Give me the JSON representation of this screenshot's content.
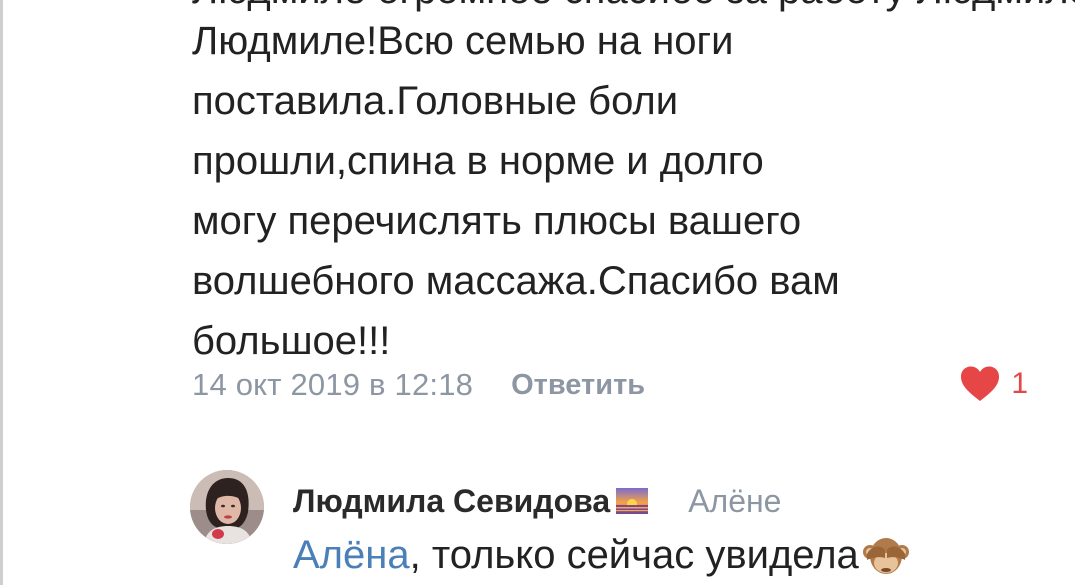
{
  "comment": {
    "cut_top_line": "Людмиле огромное спасибо за работу Людмиле",
    "lines": [
      "Людмиле!Всю семью на ноги",
      "поставила.Головные боли",
      "прошли,спина в норме и долго",
      "могу перечислять плюсы вашего",
      "волшебного массажа.Спасибо вам",
      "большое!!!"
    ],
    "timestamp": "14 окт 2019 в 12:18",
    "reply_label": "Ответить",
    "like_count": "1",
    "like_color": "#e64646"
  },
  "reply": {
    "author": "Людмила Севидова",
    "author_badge_icon": "sunset-emoji-icon",
    "reply_to": "Алёне",
    "mention": "Алёна",
    "text": ", только сейчас увидела",
    "trailing_icon": "see-no-evil-monkey-icon",
    "link_color": "#4a7fb8"
  }
}
